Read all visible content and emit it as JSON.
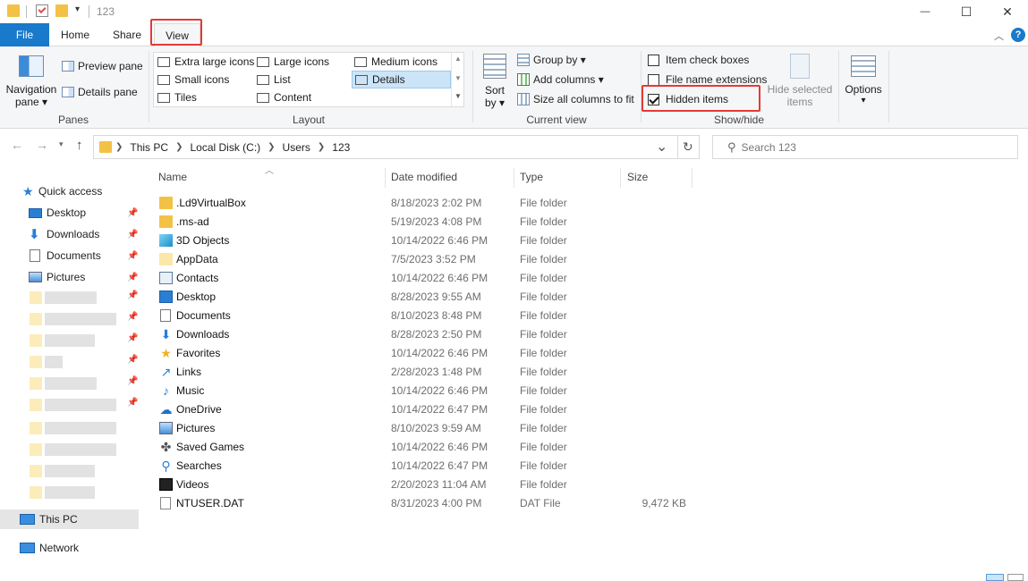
{
  "window": {
    "title": "123",
    "minimize_glyph": "—",
    "maximize_glyph": "☐",
    "close_glyph": "✕"
  },
  "tabs": {
    "file": "File",
    "home": "Home",
    "share": "Share",
    "view": "View"
  },
  "ribbon": {
    "panes": {
      "navigation_pane": "Navigation",
      "navigation_pane_2": "pane ▾",
      "preview_pane": "Preview pane",
      "details_pane": "Details pane",
      "label": "Panes"
    },
    "layout": {
      "extra_large_icons": "Extra large icons",
      "large_icons": "Large icons",
      "medium_icons": "Medium icons",
      "small_icons": "Small icons",
      "list": "List",
      "details": "Details",
      "tiles": "Tiles",
      "content": "Content",
      "label": "Layout"
    },
    "current_view": {
      "sort_by_1": "Sort",
      "sort_by_2": "by ▾",
      "group_by": "Group by ▾",
      "add_columns": "Add columns ▾",
      "size_all_columns": "Size all columns to fit",
      "label": "Current view"
    },
    "show_hide": {
      "item_check_boxes": "Item check boxes",
      "file_name_extensions": "File name extensions",
      "hidden_items": "Hidden items",
      "hide_selected_1": "Hide selected",
      "hide_selected_2": "items",
      "label": "Show/hide"
    },
    "options": {
      "label": "Options",
      "arrow": "▾"
    }
  },
  "checkboxes": {
    "item_check_boxes": false,
    "file_name_extensions": false,
    "hidden_items": true
  },
  "address": {
    "crumbs": [
      "This PC",
      "Local Disk (C:)",
      "Users",
      "123"
    ],
    "refresh_glyph": "↻",
    "dropdown_glyph": "⌄"
  },
  "search": {
    "placeholder": "Search 123"
  },
  "sidebar": {
    "quick_access": "Quick access",
    "desktop": "Desktop",
    "downloads": "Downloads",
    "documents": "Documents",
    "pictures": "Pictures",
    "this_pc": "This PC",
    "network": "Network"
  },
  "columns": {
    "name": "Name",
    "date_modified": "Date modified",
    "type": "Type",
    "size": "Size"
  },
  "files": [
    {
      "name": ".Ld9VirtualBox",
      "date": "8/18/2023 2:02 PM",
      "type": "File folder",
      "size": "",
      "icon": "folder-icon"
    },
    {
      "name": ".ms-ad",
      "date": "5/19/2023 4:08 PM",
      "type": "File folder",
      "size": "",
      "icon": "folder-icon"
    },
    {
      "name": "3D Objects",
      "date": "10/14/2022 6:46 PM",
      "type": "File folder",
      "size": "",
      "icon": "cube-icon"
    },
    {
      "name": "AppData",
      "date": "7/5/2023 3:52 PM",
      "type": "File folder",
      "size": "",
      "icon": "hidden-folder-icon"
    },
    {
      "name": "Contacts",
      "date": "10/14/2022 6:46 PM",
      "type": "File folder",
      "size": "",
      "icon": "contacts-icon"
    },
    {
      "name": "Desktop",
      "date": "8/28/2023 9:55 AM",
      "type": "File folder",
      "size": "",
      "icon": "desktop-icon"
    },
    {
      "name": "Documents",
      "date": "8/10/2023 8:48 PM",
      "type": "File folder",
      "size": "",
      "icon": "documents-icon"
    },
    {
      "name": "Downloads",
      "date": "8/28/2023 2:50 PM",
      "type": "File folder",
      "size": "",
      "icon": "download-icon"
    },
    {
      "name": "Favorites",
      "date": "10/14/2022 6:46 PM",
      "type": "File folder",
      "size": "",
      "icon": "star-icon"
    },
    {
      "name": "Links",
      "date": "2/28/2023 1:48 PM",
      "type": "File folder",
      "size": "",
      "icon": "link-icon"
    },
    {
      "name": "Music",
      "date": "10/14/2022 6:46 PM",
      "type": "File folder",
      "size": "",
      "icon": "music-icon"
    },
    {
      "name": "OneDrive",
      "date": "10/14/2022 6:47 PM",
      "type": "File folder",
      "size": "",
      "icon": "cloud-icon"
    },
    {
      "name": "Pictures",
      "date": "8/10/2023 9:59 AM",
      "type": "File folder",
      "size": "",
      "icon": "pictures-icon"
    },
    {
      "name": "Saved Games",
      "date": "10/14/2022 6:46 PM",
      "type": "File folder",
      "size": "",
      "icon": "gamepad-icon"
    },
    {
      "name": "Searches",
      "date": "10/14/2022 6:47 PM",
      "type": "File folder",
      "size": "",
      "icon": "search-icon"
    },
    {
      "name": "Videos",
      "date": "2/20/2023 11:04 AM",
      "type": "File folder",
      "size": "",
      "icon": "film-icon"
    },
    {
      "name": "NTUSER.DAT",
      "date": "8/31/2023 4:00 PM",
      "type": "DAT File",
      "size": "9,472 KB",
      "icon": "file-icon"
    }
  ],
  "colors": {
    "accent": "#1979ca",
    "highlight_box": "#e53935",
    "selected_bg": "#cce4f7"
  }
}
